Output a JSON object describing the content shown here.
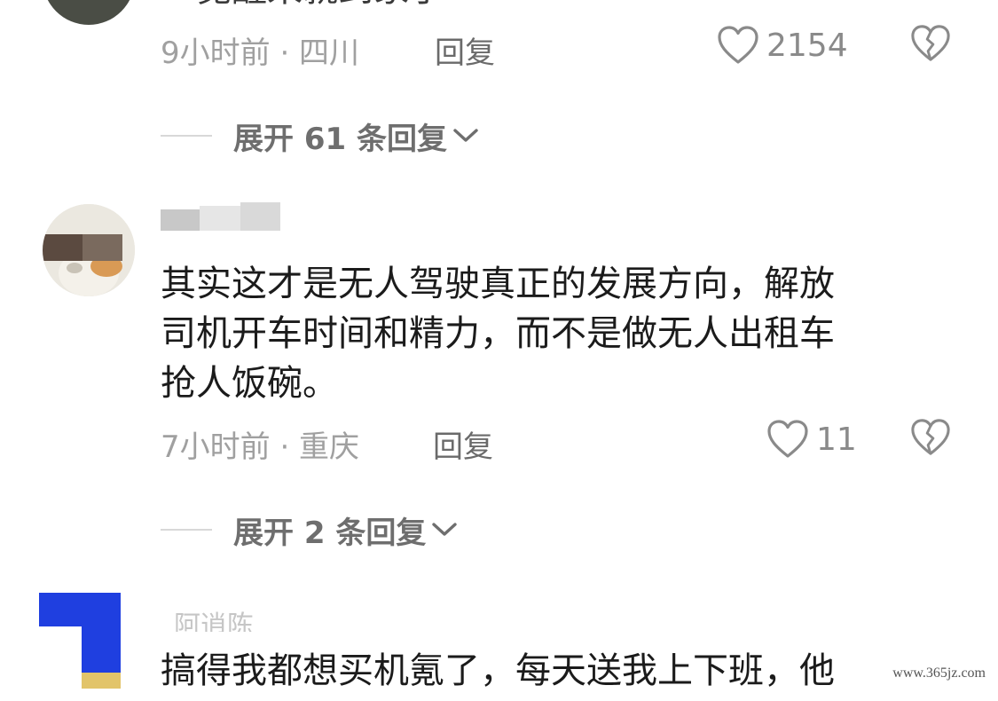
{
  "comments": [
    {
      "partial_text": "一觉醒来就到家了",
      "time_location": "9小时前 · 四川",
      "reply_label": "回复",
      "like_count": "2154",
      "expand_label": "展开 61 条回复"
    },
    {
      "text_lines": [
        "其实这才是无人驾驶真正的发展方向，解放",
        "司机开车时间和精力，而不是做无人出租车",
        "抢人饭碗。"
      ],
      "time_location": "7小时前 · 重庆",
      "reply_label": "回复",
      "like_count": "11",
      "expand_label": "展开 2 条回复"
    },
    {
      "partial_username": "阿逍陈",
      "partial_text": "搞得我都想买机氪了，每天送我上下班，他"
    }
  ],
  "watermark": "www.365jz.com",
  "colors": {
    "meta_gray": "#a0a0a0",
    "text_dark": "#1b1b1b",
    "icon_gray": "#8a8a8a",
    "blue_avatar": "#1f3fe0"
  }
}
